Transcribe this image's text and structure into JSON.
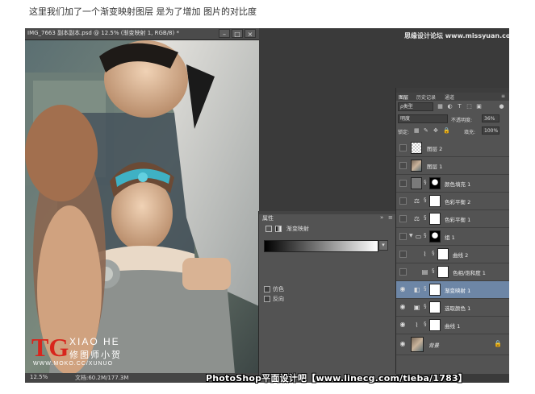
{
  "caption": "这里我们加了一个渐变映射图层 是为了增加 图片的对比度",
  "document": {
    "title": "IMG_7663 副本副本.psd @ 12.5% (渐变映射 1, RGB/8) *",
    "zoom": "12.5%",
    "doc_size": "文档:60.2M/177.3M"
  },
  "photo_watermark": {
    "logo": "TG",
    "name": "XIAO HE",
    "chinese": "修图师小贺",
    "url": "WWW.MOKO.CC/XUNUO"
  },
  "site_watermark_top": "思缘设计论坛 www.missyuan.com",
  "site_watermark_bottom": "PhotoShop平面设计吧【www.linecg.com/tieba/1783】",
  "properties": {
    "tab": "属性",
    "header": "渐变映射",
    "options": [
      "仿色",
      "反向"
    ]
  },
  "layers_panel": {
    "tabs": [
      "图层",
      "历史记录",
      "通道"
    ],
    "filter_label": "ρ类型",
    "blend_mode": "明度",
    "opacity_label": "不透明度:",
    "opacity_value": "36%",
    "lock_label": "锁定:",
    "fill_label": "填充:",
    "fill_value": "100%",
    "layers": [
      {
        "name": "图层 2",
        "visible": false,
        "selected": false
      },
      {
        "name": "图层 1",
        "visible": false,
        "selected": false
      },
      {
        "name": "颜色填充 1",
        "visible": false,
        "selected": false
      },
      {
        "name": "色彩平衡 2",
        "visible": false,
        "selected": false
      },
      {
        "name": "色彩平衡 1",
        "visible": false,
        "selected": false
      },
      {
        "name": "组 1",
        "visible": false,
        "selected": false
      },
      {
        "name": "曲线 2",
        "visible": false,
        "selected": false
      },
      {
        "name": "色相/饱和度 1",
        "visible": false,
        "selected": false
      },
      {
        "name": "渐变映射 1",
        "visible": true,
        "selected": true
      },
      {
        "name": "选取颜色 1",
        "visible": true,
        "selected": false
      },
      {
        "name": "曲线 1",
        "visible": true,
        "selected": false
      },
      {
        "name": "背景",
        "visible": true,
        "selected": false
      }
    ]
  },
  "colors": {
    "ps_background": "#3a3a3a",
    "panel": "#535353",
    "selected_layer": "#6d86a6",
    "logo_red": "#d8251c"
  }
}
